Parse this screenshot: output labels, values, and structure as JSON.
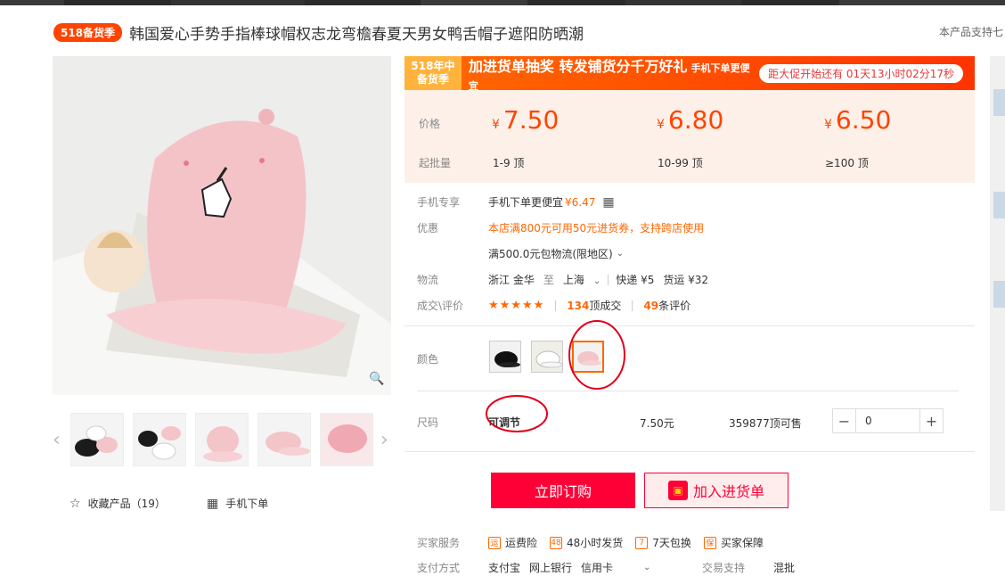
{
  "header": {
    "badge": "518备货季",
    "title": "韩国爱心手势手指棒球帽权志龙弯檐春夏天男女鸭舌帽子遮阳防晒潮",
    "support_text": "本产品支持七"
  },
  "gallery": {
    "collect_label": "收藏产品（19）",
    "mobile_order_label": "手机下单"
  },
  "promo": {
    "badge_line1": "518年中",
    "badge_line2": "备货季",
    "text": "加进货单抽奖 转发铺货分千万好礼",
    "small_text": "手机下单更便宜",
    "countdown": "距大促开始还有 01天13小时02分17秒"
  },
  "pricing": {
    "price_label": "价格",
    "qty_label": "起批量",
    "currency": "¥",
    "tiers": [
      {
        "price": "7.50",
        "qty": "1-9 顶"
      },
      {
        "price": "6.80",
        "qty": "10-99 顶"
      },
      {
        "price": "6.50",
        "qty": "≥100 顶"
      }
    ]
  },
  "details": {
    "mobile_label": "手机专享",
    "mobile_text": "手机下单更便宜",
    "mobile_price": "¥6.47",
    "promo_label": "优惠",
    "coupon_text": "本店满800元可用50元进货券，支持跨店使用",
    "shipping_free": "满500.0元包物流(限地区)",
    "logistics_label": "物流",
    "from": "浙江 金华",
    "to_word": "至",
    "dest": "上海",
    "express": "快递 ¥5",
    "freight": "货运 ¥32",
    "trade_label": "成交\\评价",
    "stars": "★★★★★",
    "deals_count": "134",
    "deals_unit": "顶成交",
    "reviews_count": "49",
    "reviews_unit": "条评价"
  },
  "color": {
    "label": "颜色",
    "swatches": [
      "black",
      "white",
      "pink"
    ],
    "selected": "pink"
  },
  "size": {
    "label": "尺码",
    "value": "可调节",
    "price": "7.50元",
    "stock": "359877顶可售",
    "quantity": "0",
    "minus": "−",
    "plus": "+"
  },
  "actions": {
    "order_label": "立即订购",
    "cart_label": "加入进货单"
  },
  "services": {
    "label": "买家服务",
    "items": [
      "运费险",
      "48小时发货",
      "7天包换",
      "买家保障"
    ]
  },
  "payment": {
    "label": "支付方式",
    "methods": [
      "支付宝",
      "网上银行",
      "信用卡"
    ],
    "trade_support_label": "交易支持",
    "trade_support_value": "混批"
  },
  "colors": {
    "accent": "#ff4400",
    "order_red": "#ff0036",
    "price_bg": "#fdf0e8"
  }
}
